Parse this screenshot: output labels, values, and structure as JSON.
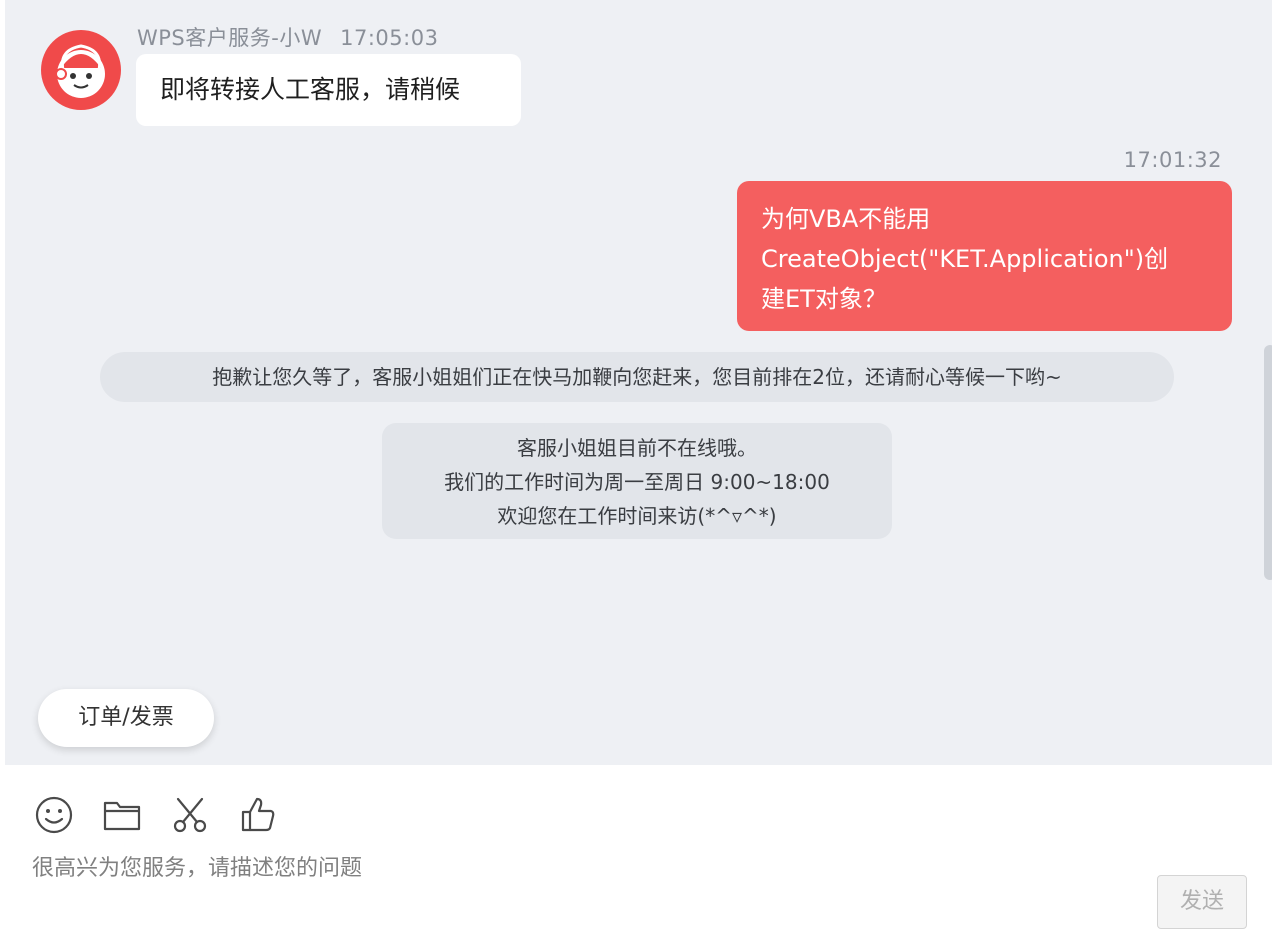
{
  "agent_message": {
    "sender": "WPS客户服务-小W",
    "time": "17:05:03",
    "text": "即将转接人工客服，请稍候"
  },
  "user_message": {
    "time": "17:01:32",
    "lines": [
      "为何VBA不能用",
      "CreateObject(\"KET.Application\")创",
      "建ET对象？"
    ]
  },
  "system_notice": "抱歉让您久等了，客服小姐姐们正在快马加鞭向您赶来，您目前排在2位，还请耐心等候一下哟~",
  "offline_notice": {
    "lines": [
      "客服小姐姐目前不在线哦。",
      "我们的工作时间为周一至周日  9:00~18:00",
      "欢迎您在工作时间来访(*^▿^*)"
    ]
  },
  "quick_reply": "订单/发票",
  "toolbar": {
    "icons": [
      "emoji-icon",
      "folder-icon",
      "scissors-icon",
      "thumbs-up-icon"
    ]
  },
  "input": {
    "placeholder": "很高兴为您服务，请描述您的问题"
  },
  "send_label": "发送",
  "colors": {
    "user_bubble": "#f45f5f",
    "chat_background": "#eef0f4",
    "avatar": "#f04a4a"
  }
}
